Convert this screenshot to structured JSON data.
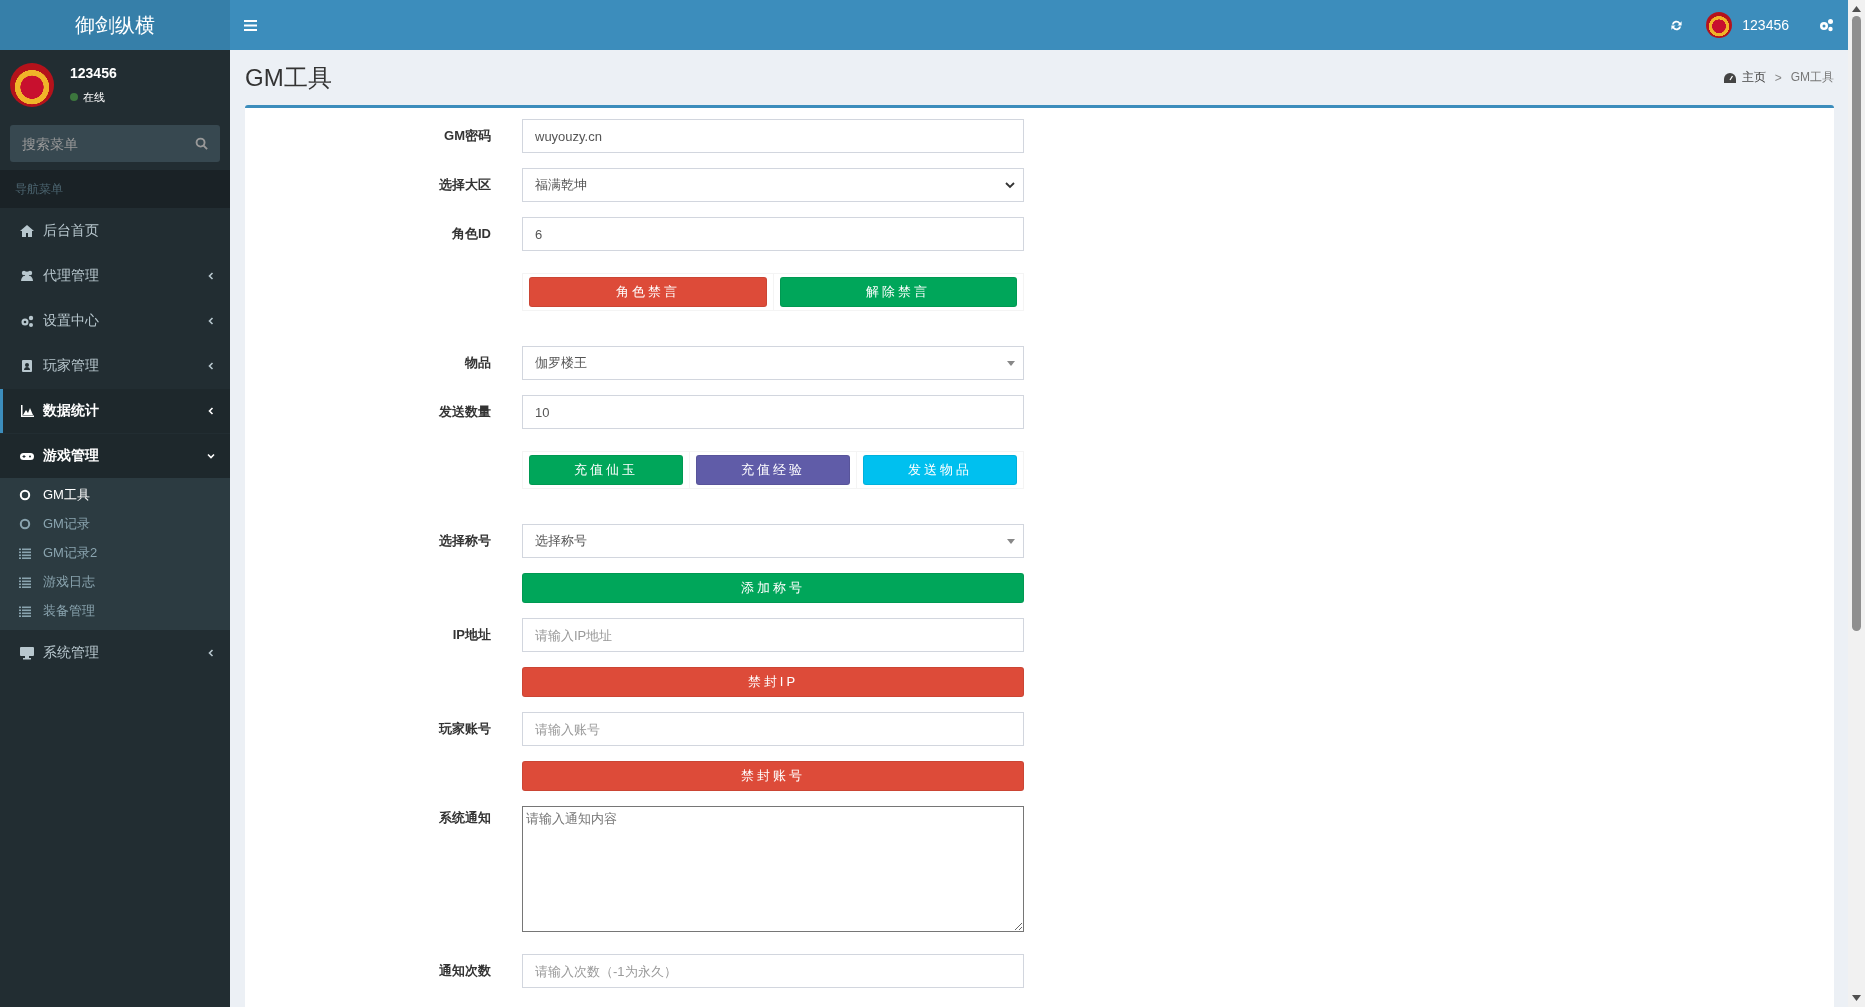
{
  "header": {
    "brand": "御剑纵横",
    "user_name": "123456"
  },
  "sidebar": {
    "user": {
      "name": "123456",
      "status": "在线"
    },
    "search": {
      "placeholder": "搜索菜单"
    },
    "section": "导航菜单",
    "items": [
      {
        "label": "后台首页",
        "selected": false
      },
      {
        "label": "代理管理",
        "selected": false,
        "expanded": false
      },
      {
        "label": "设置中心",
        "selected": false,
        "expanded": false
      },
      {
        "label": "玩家管理",
        "selected": false,
        "expanded": false
      },
      {
        "label": "数据统计",
        "selected": true,
        "expanded": false
      },
      {
        "label": "游戏管理",
        "selected": false,
        "expanded": true,
        "children": [
          {
            "label": "GM工具",
            "kind": "circle",
            "selected": true
          },
          {
            "label": "GM记录",
            "kind": "circle",
            "selected": false
          },
          {
            "label": "GM记录2",
            "kind": "list",
            "selected": false
          },
          {
            "label": "游戏日志",
            "kind": "list",
            "selected": false
          },
          {
            "label": "装备管理",
            "kind": "list",
            "selected": false
          }
        ]
      },
      {
        "label": "系统管理",
        "selected": false,
        "expanded": false
      }
    ]
  },
  "page": {
    "title": "GM工具",
    "breadcrumb": {
      "items": [
        "主页",
        "GM工具"
      ],
      "separator": ">"
    }
  },
  "form": {
    "rows": [
      {
        "kind": "input",
        "label": "GM密码",
        "value": "wuyouzy.cn"
      },
      {
        "kind": "select",
        "label": "选择大区",
        "value": "福满乾坤"
      },
      {
        "kind": "input",
        "label": "角色ID",
        "value": "6"
      },
      {
        "kind": "buttons",
        "buttons": [
          {
            "label": "角色禁言",
            "color": "#dd4b39"
          },
          {
            "label": "解除禁言",
            "color": "#00a65a"
          }
        ]
      },
      {
        "kind": "dropdown",
        "label": "物品",
        "value": "伽罗楼王"
      },
      {
        "kind": "input",
        "label": "发送数量",
        "value": "10"
      },
      {
        "kind": "buttons",
        "buttons": [
          {
            "label": "充值仙玉",
            "color": "#00a65a"
          },
          {
            "label": "充值经验",
            "color": "#605ca8"
          },
          {
            "label": "发送物品",
            "color": "#00c0ef"
          }
        ]
      },
      {
        "kind": "dropdown",
        "label": "选择称号",
        "value": "选择称号"
      },
      {
        "kind": "button",
        "text": "添加称号",
        "color": "#00a65a"
      },
      {
        "kind": "input",
        "label": "IP地址",
        "placeholder": "请输入IP地址"
      },
      {
        "kind": "button",
        "text": "禁封IP",
        "color": "#dd4b39"
      },
      {
        "kind": "input",
        "label": "玩家账号",
        "placeholder": "请输入账号"
      },
      {
        "kind": "button",
        "text": "禁封账号",
        "color": "#dd4b39"
      },
      {
        "kind": "textarea",
        "label": "系统通知",
        "placeholder": "请输入通知内容"
      },
      {
        "kind": "input",
        "label": "通知次数",
        "placeholder": "请输入次数（-1为永久）"
      }
    ]
  }
}
